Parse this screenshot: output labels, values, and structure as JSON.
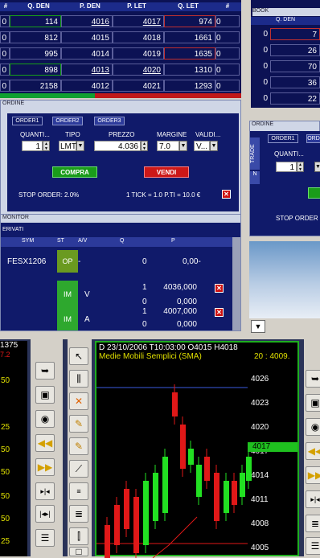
{
  "book": {
    "columns": [
      "#",
      "Q. DEN",
      "P. DEN",
      "P. LET",
      "Q. LET",
      "#"
    ],
    "rows": [
      {
        "n1": "0",
        "qden": "114",
        "pden": "4016",
        "plet": "4017",
        "qlet": "974",
        "n2": "0"
      },
      {
        "n1": "0",
        "qden": "812",
        "pden": "4015",
        "plet": "4018",
        "qlet": "1661",
        "n2": "0"
      },
      {
        "n1": "0",
        "qden": "995",
        "pden": "4014",
        "plet": "4019",
        "qlet": "1635",
        "n2": "0"
      },
      {
        "n1": "0",
        "qden": "898",
        "pden": "4013",
        "plet": "4020",
        "qlet": "1310",
        "n2": "0"
      },
      {
        "n1": "0",
        "qden": "2158",
        "pden": "4012",
        "plet": "4021",
        "qlet": "1293",
        "n2": "0"
      }
    ]
  },
  "order": {
    "window_title": "ORDINE",
    "tabs": [
      "ORDER1",
      "ORDER2",
      "ORDER3"
    ],
    "labels": {
      "qty": "QUANTI...",
      "type": "TIPO",
      "price": "PREZZO",
      "margin": "MARGINE",
      "validity": "VALIDI..."
    },
    "values": {
      "qty": "1",
      "type": "LMT",
      "price": "4.036",
      "margin": "7.0",
      "validity": "V..."
    },
    "buy_label": "COMPRA",
    "sell_label": "VENDI",
    "stop_order": "STOP ORDER: 2.0%",
    "tick_info": "1 TICK = 1.0 P.TI = 10.0 €"
  },
  "monitor": {
    "window_title": "MONITOR",
    "section": "ERIVATI",
    "columns": [
      "SYM",
      "ST",
      "A/V",
      "Q",
      "P"
    ],
    "rows": [
      {
        "sym": "FESX1206",
        "st": "OP",
        "av": "-",
        "q": "0",
        "p": "0,00-"
      },
      {
        "sym": "",
        "st": "IM",
        "av": "V",
        "q1": "1",
        "q2": "0",
        "p1": "4036,000",
        "p2": "0,000"
      },
      {
        "sym": "",
        "st": "IM",
        "av": "A",
        "q1": "1",
        "q2": "0",
        "p1": "4007,000",
        "p2": "0,000"
      }
    ]
  },
  "right_book": {
    "title": "BOOK",
    "column": "Q. DEN",
    "rows": [
      {
        "n": "0",
        "q": "7"
      },
      {
        "n": "0",
        "q": "26"
      },
      {
        "n": "0",
        "q": "70"
      },
      {
        "n": "0",
        "q": "36"
      },
      {
        "n": "0",
        "q": "22"
      }
    ]
  },
  "right_order": {
    "title": "ORDINE",
    "tabs": [
      "ORDER1",
      "ORD"
    ],
    "side_tabs": [
      "TRADE",
      "N"
    ],
    "qty_label": "QUANTI...",
    "qty_value": "1",
    "stop_order": "STOP ORDER"
  },
  "left_chart": {
    "header": "1375",
    "sub": "7.2",
    "ticks": [
      "50",
      "25",
      "50",
      "50",
      "50",
      "50",
      "25"
    ]
  },
  "main_chart": {
    "header": "D 23/10/2006  T10:03:00  O4015 H4018",
    "indicator": "Medie Mobili Semplici (SMA)",
    "period": "20 : 4009.",
    "price_levels": [
      "4026",
      "4023",
      "4020",
      "4017",
      "4014",
      "4011",
      "4008",
      "4005"
    ],
    "current_price": "4017",
    "colors": {
      "up": "#22e022",
      "down": "#e01818",
      "sma": "#e01818",
      "frame": "#1fae1f"
    }
  },
  "icons": {
    "toolbar1": [
      "yellow-arrow-icon",
      "save-icon",
      "camera-icon",
      "rewind-icon",
      "fast-forward-icon",
      "split-icon",
      "merge-icon",
      "bar-list-icon"
    ],
    "toolbar2": [
      "pointer-icon",
      "bars-icon",
      "cross-icon",
      "pencil-icon",
      "pencil-icon",
      "trendline-icon",
      "lines-icon",
      "fibo-icon",
      "candles-icon",
      "square-icon"
    ]
  }
}
